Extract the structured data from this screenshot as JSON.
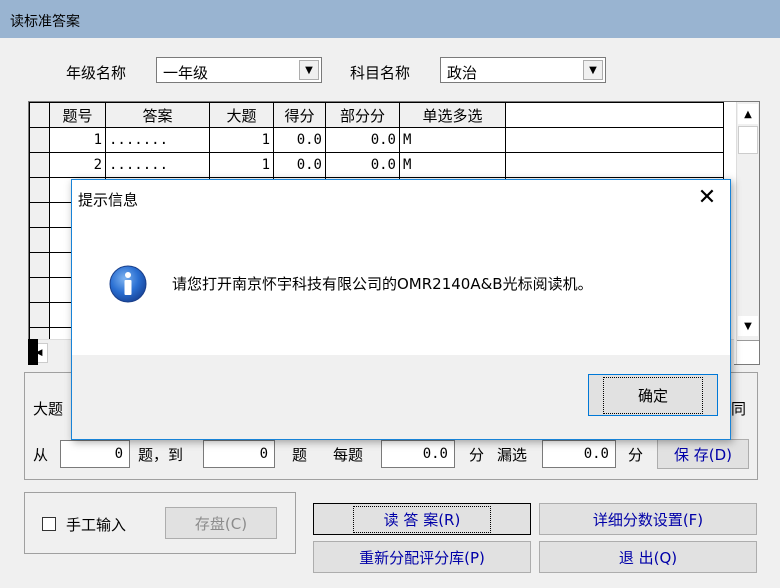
{
  "window": {
    "title": "读标准答案"
  },
  "filters": {
    "grade_label": "年级名称",
    "grade_value": "一年级",
    "subject_label": "科目名称",
    "subject_value": "政治"
  },
  "grid": {
    "columns": [
      "题号",
      "答案",
      "大题",
      "得分",
      "部分分",
      "单选多选"
    ],
    "rows": [
      [
        "1",
        ".......",
        "1",
        "0.0",
        "0.0",
        "M"
      ],
      [
        "2",
        ".......",
        "1",
        "0.0",
        "0.0",
        "M"
      ]
    ]
  },
  "range": {
    "side_label": "大题",
    "side_label_right": "同",
    "from_label": "从",
    "from_value": "0",
    "to_label": "题，到",
    "to_value": "0",
    "ti_label": "题",
    "each_label": "每题",
    "each_value": "0.0",
    "points_label": "分",
    "miss_label": "漏选",
    "miss_value": "0.0",
    "points_label2": "分",
    "save_label": "保 存(D)"
  },
  "bottom": {
    "manual_label": "手工输入",
    "store_label": "存盘(C)",
    "read_label": "读 答 案(R)",
    "detail_label": "详细分数设置(F)",
    "redistribute_label": "重新分配评分库(P)",
    "exit_label": "退  出(Q)"
  },
  "dialog": {
    "title": "提示信息",
    "message": "请您打开南京怀宇科技有限公司的OMR2140A&B光标阅读机。",
    "ok_label": "确定",
    "accent": "#1883d7"
  },
  "colors": {
    "titlebar": "#99b4d1",
    "button_text": "#0000a8"
  }
}
